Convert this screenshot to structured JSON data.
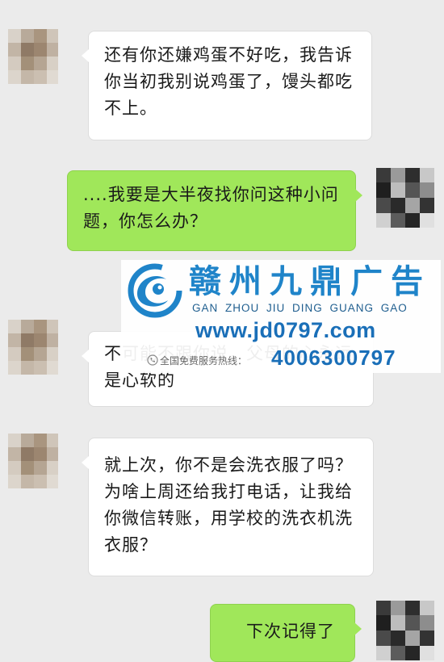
{
  "chat": {
    "messages": [
      {
        "side": "left",
        "text": "还有你还嫌鸡蛋不好吃，我告诉你当初我别说鸡蛋了，馒头都吃不上。"
      },
      {
        "side": "right",
        "text": "....我要是大半夜找你问这种小问题，你怎么办？"
      },
      {
        "side": "left",
        "text": "不可能不跟你说，父母的心永远是心软的"
      },
      {
        "side": "left",
        "text": "就上次，你不是会洗衣服了吗？为啥上周还给我打电话，让我给你微信转账，用学校的洗衣机洗衣服？"
      },
      {
        "side": "right",
        "text": "下次记得了"
      }
    ]
  },
  "ad": {
    "name": "赣州九鼎广告",
    "pinyin": "GAN ZHOU JIU DING GUANG GAO",
    "url": "www.jd0797.com",
    "hotline_label": "全国免费服务热线：",
    "phone": "4006300797",
    "brand_color": "#1f84c9"
  },
  "colors": {
    "background": "#ebebeb",
    "incoming_bubble": "#ffffff",
    "outgoing_bubble": "#a0e75a"
  },
  "icons": {
    "logo": "swirl-logo-icon",
    "hotline": "phone-icon"
  }
}
